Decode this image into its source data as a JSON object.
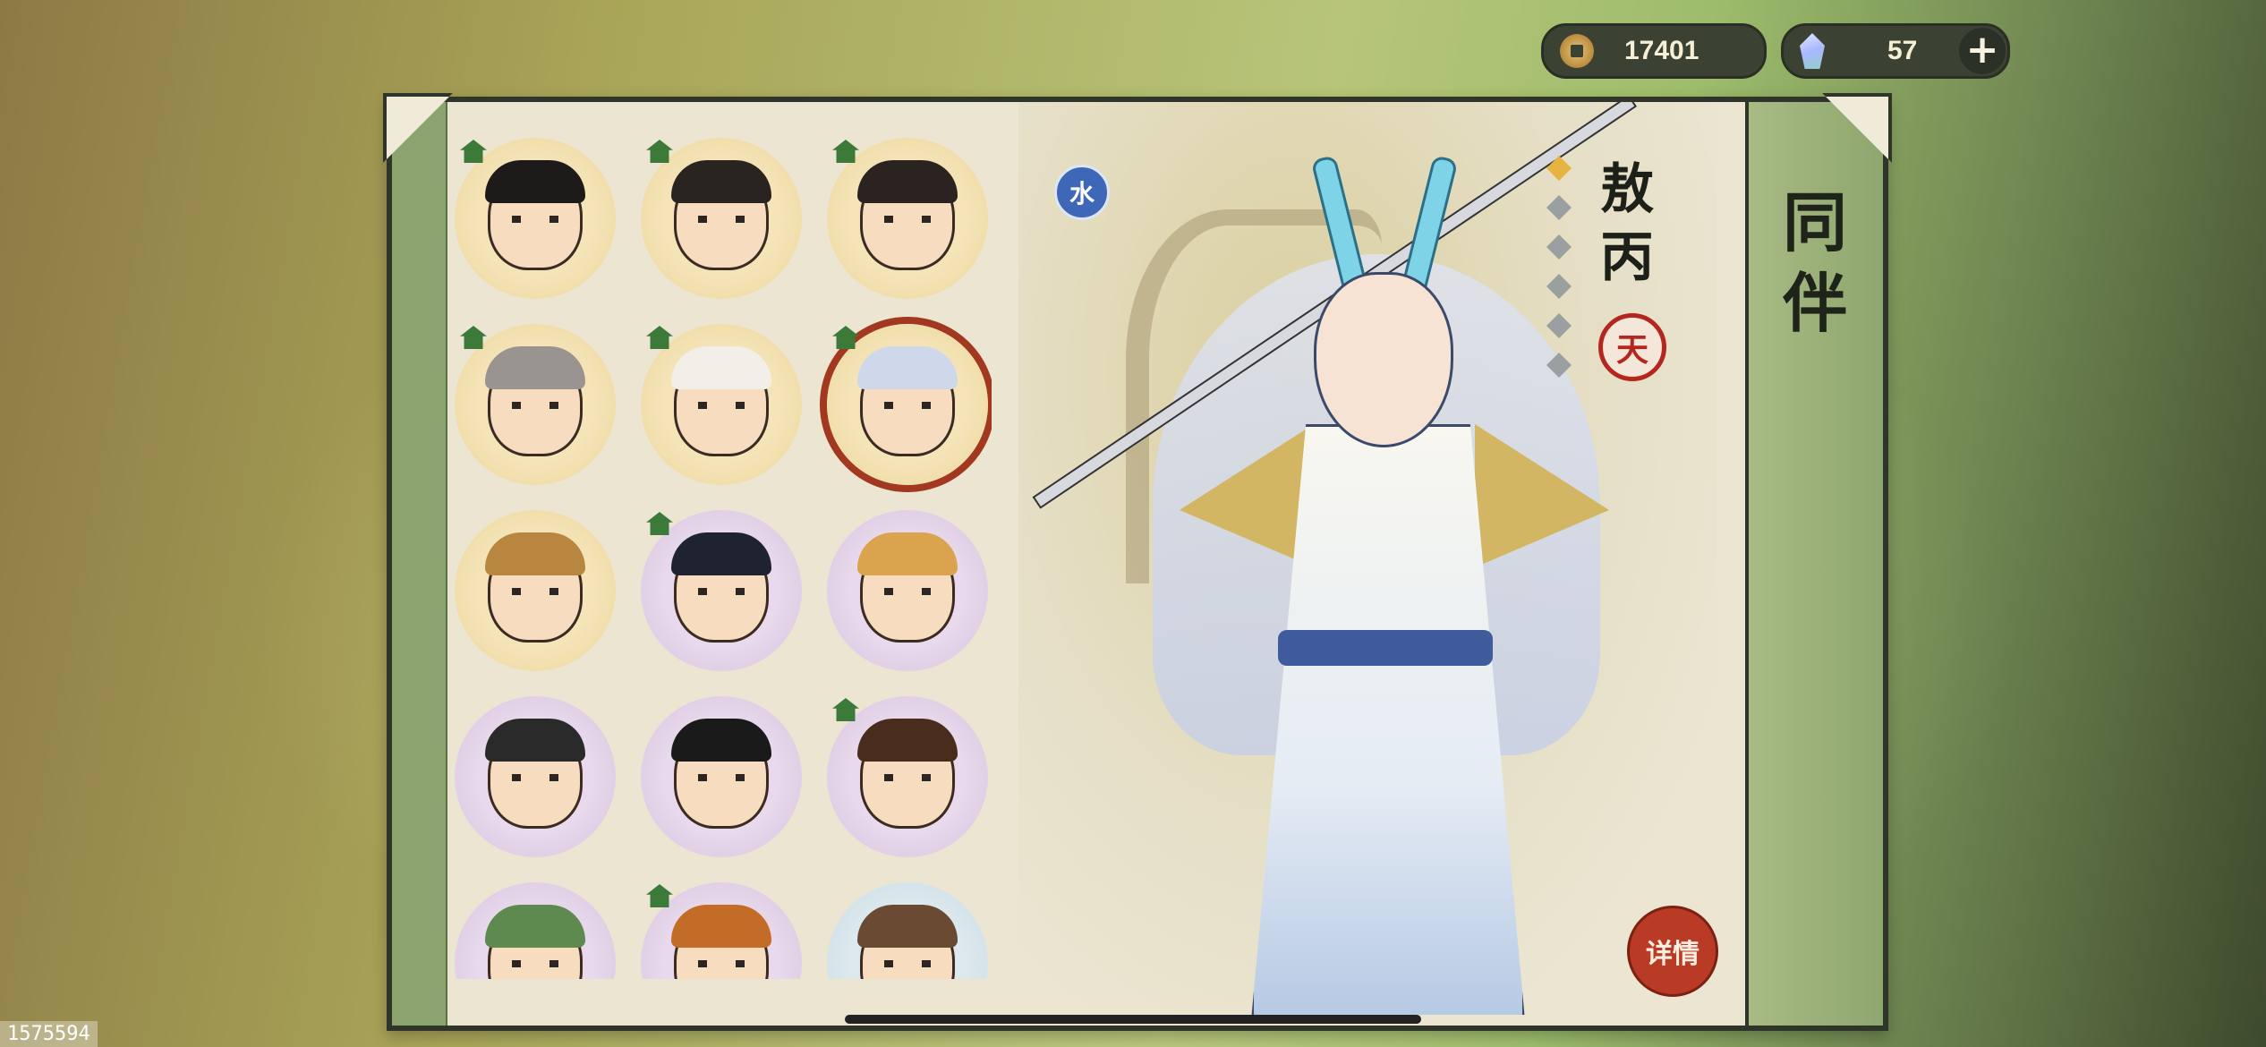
{
  "currency": {
    "coins": {
      "icon": "coin-icon",
      "value": "17401"
    },
    "gems": {
      "icon": "gem-icon",
      "value": "57"
    },
    "add_symbol": "+"
  },
  "panel": {
    "title": "同伴"
  },
  "companions": [
    {
      "frame": "gold",
      "home": true,
      "hair": "#1d1a1a",
      "selected": false
    },
    {
      "frame": "gold",
      "home": true,
      "hair": "#2a2420",
      "selected": false
    },
    {
      "frame": "gold",
      "home": true,
      "hair": "#2b2320",
      "selected": false
    },
    {
      "frame": "gold",
      "home": true,
      "hair": "#9a9490",
      "selected": false
    },
    {
      "frame": "gold",
      "home": true,
      "hair": "#f2efe9",
      "selected": false
    },
    {
      "frame": "gold",
      "home": true,
      "hair": "#cfd8ea",
      "selected": true
    },
    {
      "frame": "gold",
      "home": false,
      "hair": "#b8863f",
      "selected": false
    },
    {
      "frame": "purple",
      "home": true,
      "hair": "#1f2230",
      "selected": false
    },
    {
      "frame": "purple",
      "home": false,
      "hair": "#d9a44d",
      "selected": false
    },
    {
      "frame": "purple",
      "home": false,
      "hair": "#2a2a2a",
      "selected": false
    },
    {
      "frame": "purple",
      "home": false,
      "hair": "#1a1a1a",
      "selected": false
    },
    {
      "frame": "purple",
      "home": true,
      "hair": "#4a2c1c",
      "selected": false
    },
    {
      "frame": "purple",
      "home": false,
      "hair": "#5f8a4f",
      "selected": false
    },
    {
      "frame": "purple",
      "home": true,
      "hair": "#c26c28",
      "selected": false
    },
    {
      "frame": "blue",
      "home": false,
      "hair": "#6a4a33",
      "selected": false
    }
  ],
  "hero": {
    "element": "水",
    "name": "敖丙",
    "stars_total": 6,
    "stars_lit": 1,
    "rank": "天",
    "detail_label": "详情"
  },
  "corner_id": "1575594",
  "colors": {
    "accent_red": "#b93a25",
    "panel_bg": "#ebe5d2",
    "panel_border": "#2f3528",
    "water_blue": "#3f67b8"
  }
}
